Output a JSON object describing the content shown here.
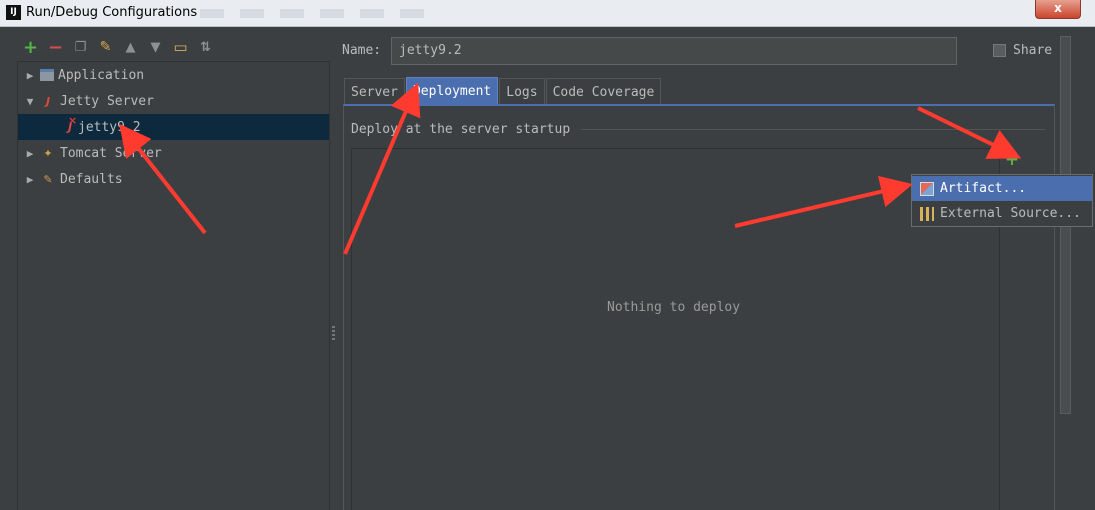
{
  "window": {
    "title": "Run/Debug Configurations",
    "app_icon": "IJ",
    "close_label": "x"
  },
  "toolbar": {
    "icons": [
      "add-icon",
      "remove-icon",
      "copy-icon",
      "wrench-icon",
      "arrow-up-icon",
      "arrow-down-icon",
      "folder-icon",
      "sort-icon"
    ]
  },
  "tree": {
    "items": [
      {
        "label": "Application",
        "icon": "application-icon",
        "expanded": false
      },
      {
        "label": "Jetty Server",
        "icon": "jetty-icon",
        "expanded": true
      },
      {
        "label": "jetty9.2",
        "icon": "jetty-config-icon",
        "selected": true
      },
      {
        "label": "Tomcat Server",
        "icon": "tomcat-icon",
        "expanded": false
      },
      {
        "label": "Defaults",
        "icon": "wrench-icon",
        "expanded": false
      }
    ]
  },
  "form": {
    "name_label": "Name:",
    "name_value": "jetty9.2",
    "share_label": "Share",
    "share_checked": false
  },
  "tabs": [
    {
      "label": "Server",
      "active": false
    },
    {
      "label": "Deployment",
      "active": true
    },
    {
      "label": "Logs",
      "active": false
    },
    {
      "label": "Code Coverage",
      "active": false
    }
  ],
  "deployment": {
    "section_title": "Deploy at the server startup",
    "empty_text": "Nothing to deploy",
    "add_label": "+"
  },
  "popup": {
    "items": [
      {
        "label": "Artifact...",
        "icon": "artifact-icon",
        "highlighted": true
      },
      {
        "label": "External Source...",
        "icon": "external-source-icon",
        "highlighted": false
      }
    ]
  },
  "colors": {
    "background": "#3c3f41",
    "selection": "#0d293e",
    "accent": "#4b6eaf",
    "add_green": "#55b348",
    "remove_red": "#d74d4d",
    "annotation_red": "#ff3b30"
  }
}
